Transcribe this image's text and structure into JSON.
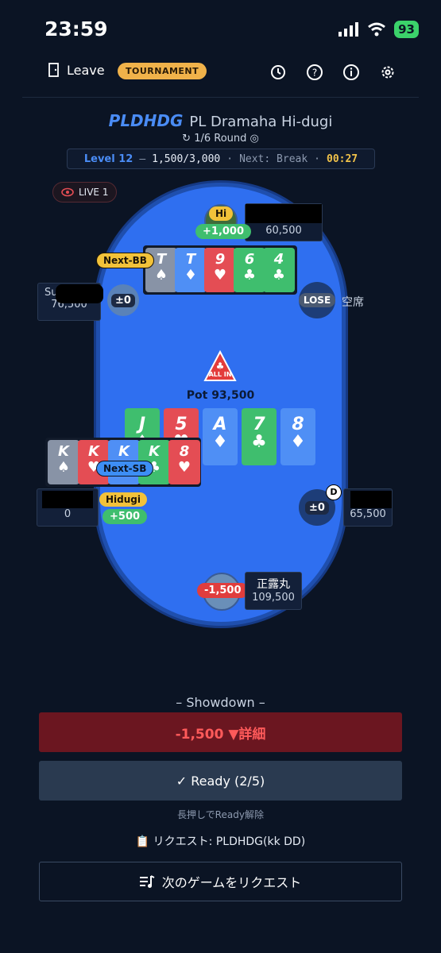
{
  "status_bar": {
    "time": "23:59",
    "battery": "93"
  },
  "header": {
    "leave_label": "Leave",
    "badge": "TOURNAMENT"
  },
  "game": {
    "code": "PLDHDG",
    "name": "PL Dramaha Hi-dugi",
    "round": "1/6 Round",
    "level_label": "Level 12",
    "blinds": "1,500/3,000",
    "next_label": "Next: Break",
    "timer": "00:27",
    "live": "LIVE 1"
  },
  "table": {
    "pot": "Pot 93,500",
    "allin_label": "ALL IN",
    "board": [
      {
        "rank": "J",
        "suit": "♠",
        "color": "green"
      },
      {
        "rank": "5",
        "suit": "♥",
        "color": "red"
      },
      {
        "rank": "A",
        "suit": "♦",
        "color": "blue"
      },
      {
        "rank": "7",
        "suit": "♣",
        "color": "green"
      },
      {
        "rank": "8",
        "suit": "♦",
        "color": "blue"
      }
    ],
    "top_hand": [
      {
        "rank": "T",
        "suit": "♠",
        "color": "grey"
      },
      {
        "rank": "T",
        "suit": "♦",
        "color": "blue"
      },
      {
        "rank": "9",
        "suit": "♥",
        "color": "red"
      },
      {
        "rank": "6",
        "suit": "♣",
        "color": "green"
      },
      {
        "rank": "4",
        "suit": "♣",
        "color": "green"
      }
    ],
    "left_hand": [
      {
        "rank": "K",
        "suit": "♠",
        "color": "grey"
      },
      {
        "rank": "K",
        "suit": "♥",
        "color": "red"
      },
      {
        "rank": "K",
        "suit": "♦",
        "color": "blue"
      },
      {
        "rank": "K",
        "suit": "♣",
        "color": "green"
      },
      {
        "rank": "8",
        "suit": "♥",
        "color": "red"
      }
    ]
  },
  "players": {
    "top": {
      "badge": "Hi",
      "delta": "+1,000",
      "stack": "60,500",
      "marker": "Next-BB"
    },
    "left_upper": {
      "name": "Su",
      "stack": "76,500",
      "delta": "±0"
    },
    "right_upper": {
      "result": "LOSE",
      "seat": "空席"
    },
    "left_lower": {
      "stack": "0",
      "badge": "Hidugi",
      "delta": "+500",
      "marker": "Next-SB"
    },
    "right_lower": {
      "delta": "±0",
      "dealer": "D",
      "stack": "65,500"
    },
    "bottom": {
      "name": "正露丸",
      "stack": "109,500",
      "delta": "-1,500"
    }
  },
  "bottom": {
    "showdown": "– Showdown –",
    "result": "-1,500 ▼詳細",
    "ready": "✓ Ready (2/5)",
    "hint": "長押しでReady解除",
    "request": "📋 リクエスト: PLDHDG(kk DD)",
    "next_request": "次のゲームをリクエスト"
  }
}
